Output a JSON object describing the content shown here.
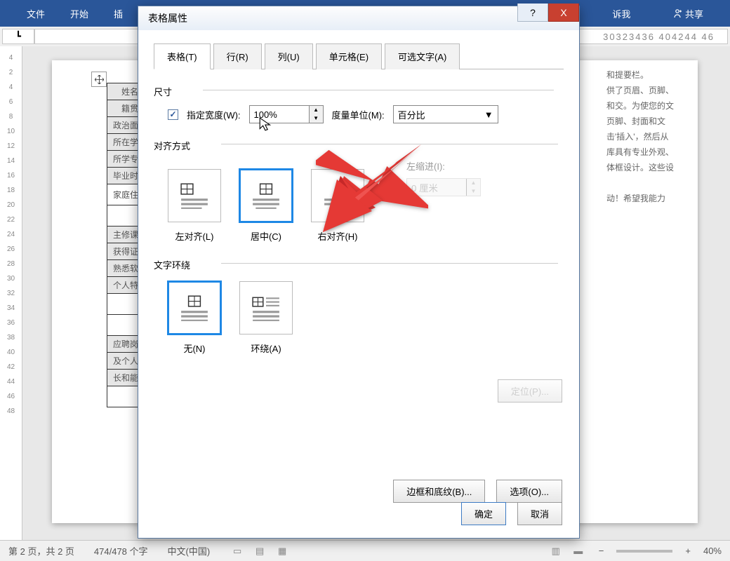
{
  "ribbon": {
    "file": "文件",
    "start": "开始",
    "insert": "插",
    "tellme": "诉我",
    "share": "共享"
  },
  "ruler": {
    "corner": "┗",
    "numbers": "30323436 404244 46"
  },
  "v_ruler": [
    "4",
    "2",
    "4",
    "6",
    "8",
    "10",
    "12",
    "14",
    "16",
    "18",
    "20",
    "22",
    "24",
    "26",
    "28",
    "30",
    "32",
    "34",
    "36",
    "38",
    "40",
    "42",
    "44",
    "46",
    "48"
  ],
  "table": {
    "r1": "姓名",
    "r2": "籍贯",
    "r3": "政治面貌",
    "r4": "所在学院",
    "r5": "所学专业",
    "r6": "毕业时间",
    "r7": "家庭住址",
    "r8": "主修课程",
    "r9": "获得证书",
    "r10": "熟悉软件",
    "r11": "个人特点",
    "r12": "应聘岗位",
    "r13": "及个人特",
    "r14": "长和能力"
  },
  "side_text": [
    "和提要栏。",
    "供了页眉、页脚、",
    "和交。为使您的文",
    "页脚、封面和文",
    "击'插入'，然后从",
    "库具有专业外观、",
    "体框设计。这些设",
    "动！希望我能力"
  ],
  "status": {
    "page": "第 2 页，共 2 页",
    "words": "474/478 个字",
    "lang": "中文(中国)",
    "zoom": "40%",
    "minus": "−",
    "plus": "+"
  },
  "dialog": {
    "title": "表格属性",
    "tabs": {
      "table": "表格(T)",
      "row": "行(R)",
      "col": "列(U)",
      "cell": "单元格(E)",
      "alt": "可选文字(A)"
    },
    "size_label": "尺寸",
    "width_check": "指定宽度(W):",
    "width_value": "100%",
    "unit_label": "度量单位(M):",
    "unit_value": "百分比",
    "align_label": "对齐方式",
    "align_left": "左对齐(L)",
    "align_center": "居中(C)",
    "align_right": "右对齐(H)",
    "indent_label": "左缩进(I):",
    "indent_value": "0 厘米",
    "wrap_label": "文字环绕",
    "wrap_none": "无(N)",
    "wrap_around": "环绕(A)",
    "positioning": "定位(P)...",
    "borders": "边框和底纹(B)...",
    "options": "选项(O)...",
    "ok": "确定",
    "cancel": "取消",
    "help": "?",
    "close": "X"
  }
}
